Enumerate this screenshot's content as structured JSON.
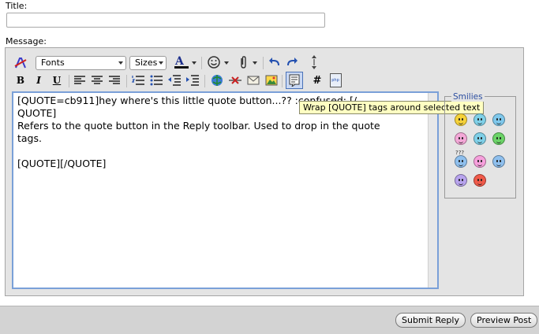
{
  "form": {
    "title_label": "Title:",
    "message_label": "Message:",
    "title_value": ""
  },
  "toolbar": {
    "font_select": "Fonts",
    "size_select": "Sizes",
    "bold": "B",
    "italic": "I",
    "underline": "U",
    "code_label": "#",
    "php_label": "php"
  },
  "editor": {
    "text": "[QUOTE=cb911]hey where's this little quote button...?? :confused: [/\nQUOTE]\nRefers to the quote button in the Reply toolbar. Used to drop in the quote\ntags.\n\n[QUOTE][/QUOTE]"
  },
  "tooltip": {
    "text": "Wrap [QUOTE] tags around selected text"
  },
  "smilies": {
    "legend": "Smilies",
    "question_marks": "???",
    "items": [
      "smile",
      "cool",
      "sunglasses",
      "tongue",
      "wink",
      "grin",
      "confused",
      "redface",
      "eek",
      "rolleyes",
      "mad"
    ]
  },
  "buttons": {
    "submit": "Submit Reply",
    "preview": "Preview Post"
  },
  "colors": {
    "panel_bg": "#e4e4e4",
    "editor_border": "#7aa0d8",
    "tooltip_bg": "#ffffc2",
    "smilies_legend": "#2c4ea0"
  }
}
